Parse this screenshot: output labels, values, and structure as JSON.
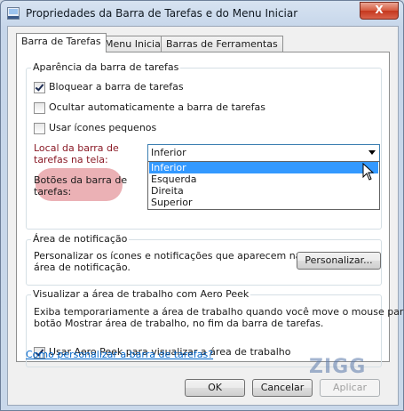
{
  "window": {
    "title": "Propriedades da Barra de Tarefas e do Menu Iniciar",
    "close_label": "X"
  },
  "tabs": [
    {
      "label": "Barra de Tarefas",
      "active": true
    },
    {
      "label": "Menu Iniciar",
      "active": false
    },
    {
      "label": "Barras de Ferramentas",
      "active": false
    }
  ],
  "appearance": {
    "title": "Aparência da barra de tarefas",
    "lock": {
      "label": "Bloquear a barra de tarefas",
      "checked": true
    },
    "autohide": {
      "label": "Ocultar automaticamente a barra de tarefas",
      "checked": false
    },
    "small_icons": {
      "label": "Usar ícones pequenos",
      "checked": false
    },
    "location_label": "Local da barra de tarefas na tela:",
    "location_line1": "Local da barra de",
    "location_line2": "tarefas na tela:",
    "location_value": "Inferior",
    "location_options": [
      "Inferior",
      "Esquerda",
      "Direita",
      "Superior"
    ],
    "buttons_line1": "Botões da barra de",
    "buttons_line2": "tarefas:"
  },
  "notification": {
    "title": "Área de notificação",
    "text_line1": "Personalizar os ícones e notificações que aparecem na",
    "text_line2": "área de notificação.",
    "button": "Personalizar..."
  },
  "aero_peek": {
    "title": "Visualizar a área de trabalho com Aero Peek",
    "text_line1": "Exiba temporariamente a área de trabalho quando você move o mouse para o",
    "text_line2": "botão Mostrar área de trabalho, no fim da barra de tarefas.",
    "checkbox": {
      "label": "Usar Aero Peek para visualizar a área de trabalho",
      "checked": true
    }
  },
  "help_link": "Como personalizar a barra de tarefas?",
  "footer": {
    "ok": "OK",
    "cancel": "Cancelar",
    "apply": "Aplicar"
  },
  "watermark": "ZIGG",
  "colors": {
    "selection": "#3399ff",
    "link": "#0066cc",
    "highlight": "#e8a3a8"
  }
}
